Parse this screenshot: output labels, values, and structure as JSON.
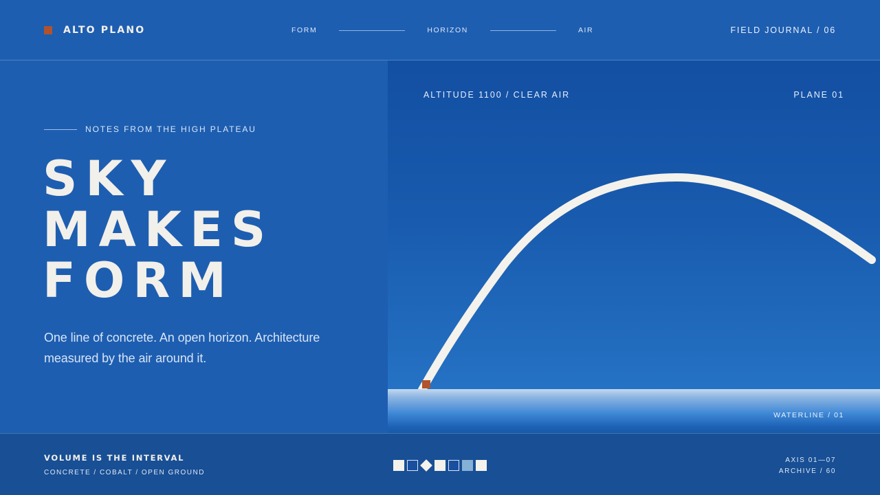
{
  "header": {
    "brand": "ALTO PLANO",
    "nav": [
      {
        "label": "FORM"
      },
      {
        "label": "HORIZON"
      },
      {
        "label": "AIR"
      }
    ],
    "journal": "FIELD JOURNAL / 06"
  },
  "hero": {
    "eyebrow": "NOTES FROM THE HIGH PLATEAU",
    "headline": [
      "SKY",
      "MAKES",
      "FORM"
    ],
    "lede": "One line of concrete. An open horizon. Architecture measured by the air around it."
  },
  "panel": {
    "label_left": "ALTITUDE 1100 / CLEAR AIR",
    "label_right": "PLANE 01",
    "waterline": "WATERLINE / 01"
  },
  "footer": {
    "title": "VOLUME IS THE INTERVAL",
    "subtitle": "CONCRETE / COBALT / OPEN GROUND",
    "swatches": [
      "white-square",
      "outline-square",
      "white-diamond",
      "white-square",
      "outline-square",
      "pale-square",
      "white-square"
    ],
    "axis": "AXIS 01—07",
    "archive": "ARCHIVE / 60"
  },
  "colors": {
    "background": "#1d5eb1",
    "accent": "#b0532e",
    "ink": "#f2f0ea",
    "footer": "#184f95"
  }
}
